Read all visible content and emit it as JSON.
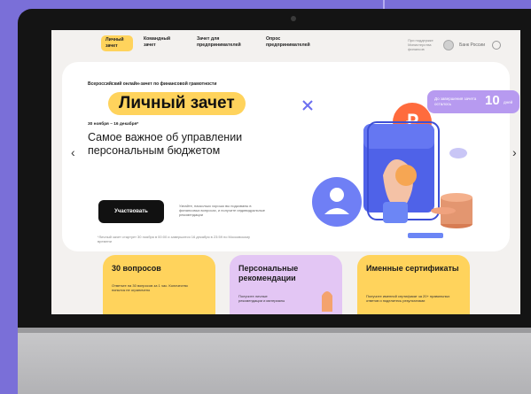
{
  "header": {
    "tabs": [
      {
        "label": "Личный зачет",
        "active": true
      },
      {
        "label": "Командный зачет",
        "active": false
      },
      {
        "label": "Зачет для предпринимателей",
        "active": false
      },
      {
        "label": "Опрос предпринимателей",
        "active": false
      }
    ],
    "partner_text": "При поддержке Министерства финансов",
    "bank_label": "Банк России"
  },
  "hero": {
    "subtitle": "Всероссийский онлайн-зачет по финансовой грамотности",
    "title": "Личный зачет",
    "dates": "30 ноября – 16 декабря*",
    "tagline": "Самое важное об управлении персональным бюджетом",
    "cta_label": "Участвовать",
    "consent": "Узнайте, насколько хорошо вы подкованы в финансовых вопросах, и получите индивидуальные рекомендации",
    "note": "*Личный зачет стартует 30 ноября в 00:00 и завершится 16 декабря в 23:59 по Московскому времени"
  },
  "countdown": {
    "label": "До завершения зачета осталось",
    "value": "10",
    "unit": "дней"
  },
  "cards": [
    {
      "title": "30 вопросов",
      "text": "Ответьте на 30 вопросов за 1 час. Количество попыток не ограничено",
      "color": "#ffd35c"
    },
    {
      "title": "Персональные рекомендации",
      "text": "Получите личные рекомендации и материалы",
      "color": "#e3c6f4"
    },
    {
      "title": "Именные сертификаты",
      "text": "Получите именной сертификат за 20+ правильных ответов и поделитесь результатами",
      "color": "#ffd35c"
    }
  ],
  "colors": {
    "accent": "#ffd35c",
    "background": "#7a6fd8",
    "countdown": "#b79af0"
  }
}
